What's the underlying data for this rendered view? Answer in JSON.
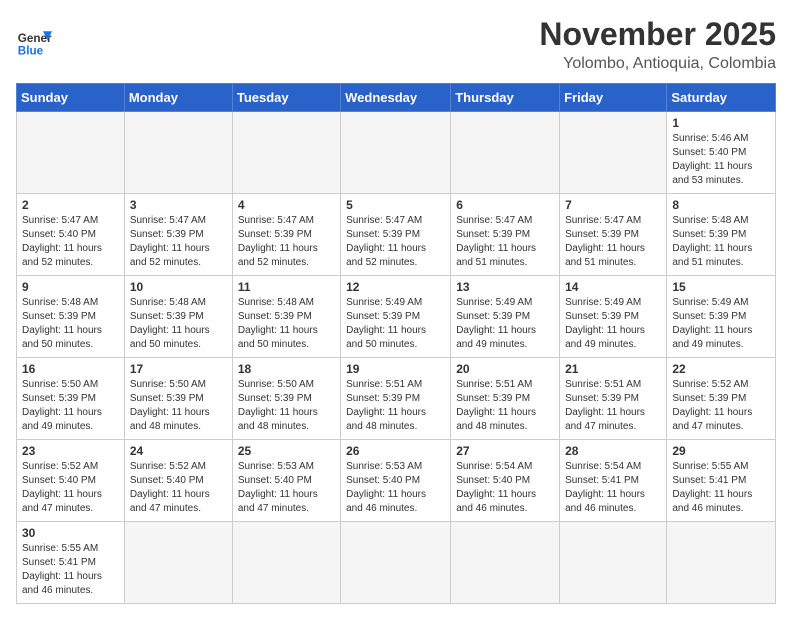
{
  "header": {
    "logo_general": "General",
    "logo_blue": "Blue",
    "month_title": "November 2025",
    "location": "Yolombo, Antioquia, Colombia"
  },
  "days_of_week": [
    "Sunday",
    "Monday",
    "Tuesday",
    "Wednesday",
    "Thursday",
    "Friday",
    "Saturday"
  ],
  "weeks": [
    [
      {
        "day": "",
        "info": ""
      },
      {
        "day": "",
        "info": ""
      },
      {
        "day": "",
        "info": ""
      },
      {
        "day": "",
        "info": ""
      },
      {
        "day": "",
        "info": ""
      },
      {
        "day": "",
        "info": ""
      },
      {
        "day": "1",
        "info": "Sunrise: 5:46 AM\nSunset: 5:40 PM\nDaylight: 11 hours\nand 53 minutes."
      }
    ],
    [
      {
        "day": "2",
        "info": "Sunrise: 5:47 AM\nSunset: 5:40 PM\nDaylight: 11 hours\nand 52 minutes."
      },
      {
        "day": "3",
        "info": "Sunrise: 5:47 AM\nSunset: 5:39 PM\nDaylight: 11 hours\nand 52 minutes."
      },
      {
        "day": "4",
        "info": "Sunrise: 5:47 AM\nSunset: 5:39 PM\nDaylight: 11 hours\nand 52 minutes."
      },
      {
        "day": "5",
        "info": "Sunrise: 5:47 AM\nSunset: 5:39 PM\nDaylight: 11 hours\nand 52 minutes."
      },
      {
        "day": "6",
        "info": "Sunrise: 5:47 AM\nSunset: 5:39 PM\nDaylight: 11 hours\nand 51 minutes."
      },
      {
        "day": "7",
        "info": "Sunrise: 5:47 AM\nSunset: 5:39 PM\nDaylight: 11 hours\nand 51 minutes."
      },
      {
        "day": "8",
        "info": "Sunrise: 5:48 AM\nSunset: 5:39 PM\nDaylight: 11 hours\nand 51 minutes."
      }
    ],
    [
      {
        "day": "9",
        "info": "Sunrise: 5:48 AM\nSunset: 5:39 PM\nDaylight: 11 hours\nand 50 minutes."
      },
      {
        "day": "10",
        "info": "Sunrise: 5:48 AM\nSunset: 5:39 PM\nDaylight: 11 hours\nand 50 minutes."
      },
      {
        "day": "11",
        "info": "Sunrise: 5:48 AM\nSunset: 5:39 PM\nDaylight: 11 hours\nand 50 minutes."
      },
      {
        "day": "12",
        "info": "Sunrise: 5:49 AM\nSunset: 5:39 PM\nDaylight: 11 hours\nand 50 minutes."
      },
      {
        "day": "13",
        "info": "Sunrise: 5:49 AM\nSunset: 5:39 PM\nDaylight: 11 hours\nand 49 minutes."
      },
      {
        "day": "14",
        "info": "Sunrise: 5:49 AM\nSunset: 5:39 PM\nDaylight: 11 hours\nand 49 minutes."
      },
      {
        "day": "15",
        "info": "Sunrise: 5:49 AM\nSunset: 5:39 PM\nDaylight: 11 hours\nand 49 minutes."
      }
    ],
    [
      {
        "day": "16",
        "info": "Sunrise: 5:50 AM\nSunset: 5:39 PM\nDaylight: 11 hours\nand 49 minutes."
      },
      {
        "day": "17",
        "info": "Sunrise: 5:50 AM\nSunset: 5:39 PM\nDaylight: 11 hours\nand 48 minutes."
      },
      {
        "day": "18",
        "info": "Sunrise: 5:50 AM\nSunset: 5:39 PM\nDaylight: 11 hours\nand 48 minutes."
      },
      {
        "day": "19",
        "info": "Sunrise: 5:51 AM\nSunset: 5:39 PM\nDaylight: 11 hours\nand 48 minutes."
      },
      {
        "day": "20",
        "info": "Sunrise: 5:51 AM\nSunset: 5:39 PM\nDaylight: 11 hours\nand 48 minutes."
      },
      {
        "day": "21",
        "info": "Sunrise: 5:51 AM\nSunset: 5:39 PM\nDaylight: 11 hours\nand 47 minutes."
      },
      {
        "day": "22",
        "info": "Sunrise: 5:52 AM\nSunset: 5:39 PM\nDaylight: 11 hours\nand 47 minutes."
      }
    ],
    [
      {
        "day": "23",
        "info": "Sunrise: 5:52 AM\nSunset: 5:40 PM\nDaylight: 11 hours\nand 47 minutes."
      },
      {
        "day": "24",
        "info": "Sunrise: 5:52 AM\nSunset: 5:40 PM\nDaylight: 11 hours\nand 47 minutes."
      },
      {
        "day": "25",
        "info": "Sunrise: 5:53 AM\nSunset: 5:40 PM\nDaylight: 11 hours\nand 47 minutes."
      },
      {
        "day": "26",
        "info": "Sunrise: 5:53 AM\nSunset: 5:40 PM\nDaylight: 11 hours\nand 46 minutes."
      },
      {
        "day": "27",
        "info": "Sunrise: 5:54 AM\nSunset: 5:40 PM\nDaylight: 11 hours\nand 46 minutes."
      },
      {
        "day": "28",
        "info": "Sunrise: 5:54 AM\nSunset: 5:41 PM\nDaylight: 11 hours\nand 46 minutes."
      },
      {
        "day": "29",
        "info": "Sunrise: 5:55 AM\nSunset: 5:41 PM\nDaylight: 11 hours\nand 46 minutes."
      }
    ],
    [
      {
        "day": "30",
        "info": "Sunrise: 5:55 AM\nSunset: 5:41 PM\nDaylight: 11 hours\nand 46 minutes."
      },
      {
        "day": "",
        "info": ""
      },
      {
        "day": "",
        "info": ""
      },
      {
        "day": "",
        "info": ""
      },
      {
        "day": "",
        "info": ""
      },
      {
        "day": "",
        "info": ""
      },
      {
        "day": "",
        "info": ""
      }
    ]
  ]
}
